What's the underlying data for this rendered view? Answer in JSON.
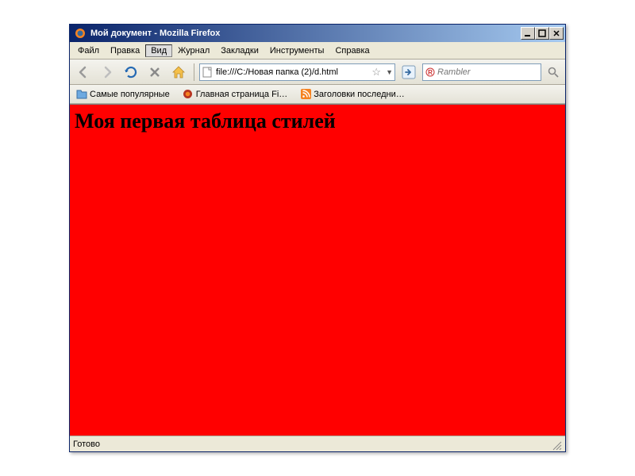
{
  "window": {
    "title": "Мой документ - Mozilla Firefox"
  },
  "menu": {
    "file": "Файл",
    "edit": "Правка",
    "view": "Вид",
    "history": "Журнал",
    "bookmarks": "Закладки",
    "tools": "Инструменты",
    "help": "Справка"
  },
  "toolbar": {
    "url": "file:///C:/Новая папка (2)/d.html",
    "search_placeholder": "Rambler"
  },
  "bookmarks": {
    "b1": "Самые популярные",
    "b2": "Главная страница Fi…",
    "b3": "Заголовки последни…"
  },
  "page": {
    "heading": "Моя первая таблица стилей",
    "background": "#ff0000"
  },
  "status": {
    "text": "Готово"
  }
}
